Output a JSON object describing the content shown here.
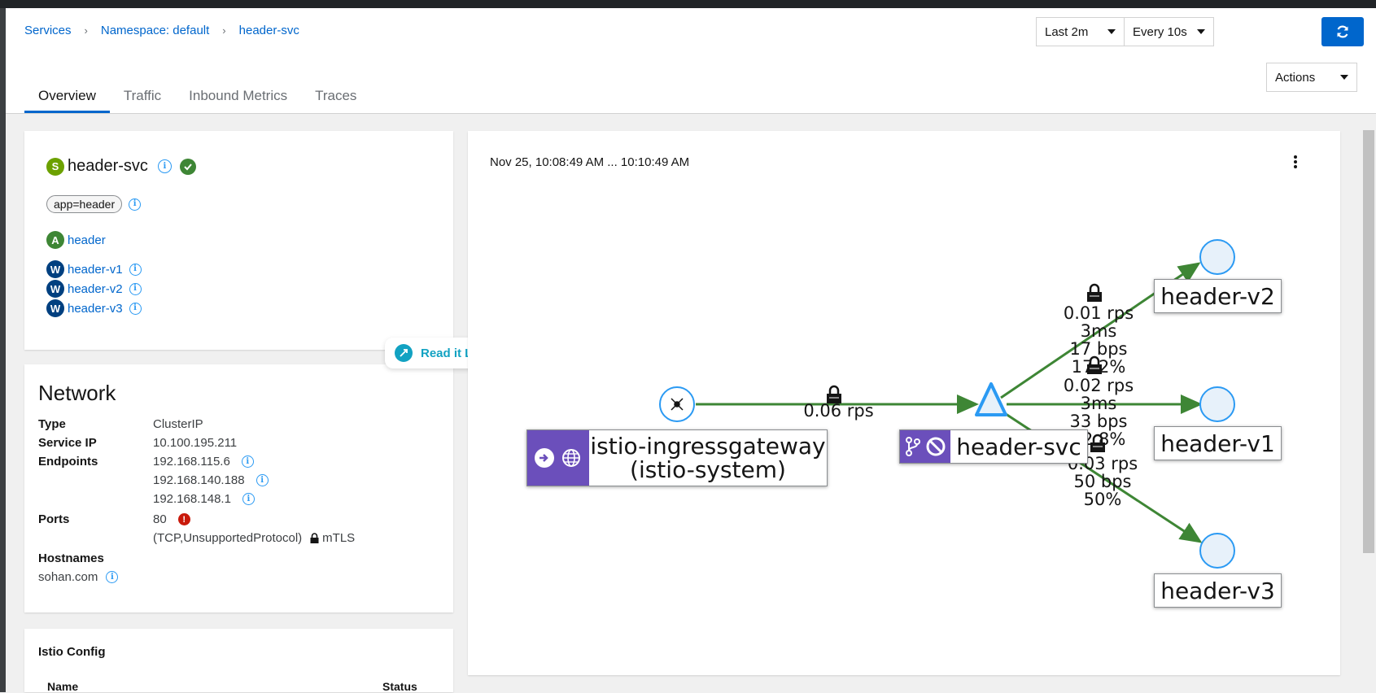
{
  "breadcrumb": [
    "Services",
    "Namespace: default",
    "header-svc"
  ],
  "toolbar": {
    "duration": "Last 2m",
    "interval": "Every 10s",
    "actions": "Actions"
  },
  "tabs": [
    "Overview",
    "Traffic",
    "Inbound Metrics",
    "Traces"
  ],
  "service": {
    "badge": "S",
    "name": "header-svc",
    "label": "app=header",
    "app_badge": "A",
    "app": "header",
    "workload_badge": "W",
    "workloads": [
      "header-v1",
      "header-v2",
      "header-v3"
    ]
  },
  "network": {
    "title": "Network",
    "type_label": "Type",
    "type": "ClusterIP",
    "ip_label": "Service IP",
    "ip": "10.100.195.211",
    "endpoints_label": "Endpoints",
    "endpoints": [
      "192.168.115.6",
      "192.168.140.188",
      "192.168.148.1"
    ],
    "ports_label": "Ports",
    "port": "80",
    "protocol": "(TCP,UnsupportedProtocol)",
    "mtls": "mTLS",
    "hostnames_label": "Hostnames",
    "hostname": "sohan.com"
  },
  "istio_config": {
    "title": "Istio Config",
    "col_name": "Name",
    "col_status": "Status"
  },
  "read_later": "Read it Later",
  "graph": {
    "timerange": "Nov 25, 10:08:49 AM ... 10:10:49 AM",
    "gateway_line1": "istio-ingressgateway",
    "gateway_line2": "(istio-system)",
    "service_node": "header-svc",
    "nodes": [
      "header-v2",
      "header-v1",
      "header-v3"
    ],
    "edge_gateway": "0.06 rps",
    "edge_v2": [
      "0.01 rps",
      "3ms",
      "17 bps",
      "17.2%"
    ],
    "edge_v1": [
      "0.02 rps",
      "3ms",
      "33 bps",
      "32.8%"
    ],
    "edge_v3": [
      "0.03 rps",
      "50 bps",
      "50%"
    ]
  },
  "colors": {
    "link": "#0066cc",
    "edge": "#3e8635",
    "node_purple": "#6b4fbb",
    "service_badge": "#6ca100",
    "app_badge": "#3e8635",
    "workload_badge": "#004080",
    "error": "#c9190b"
  }
}
